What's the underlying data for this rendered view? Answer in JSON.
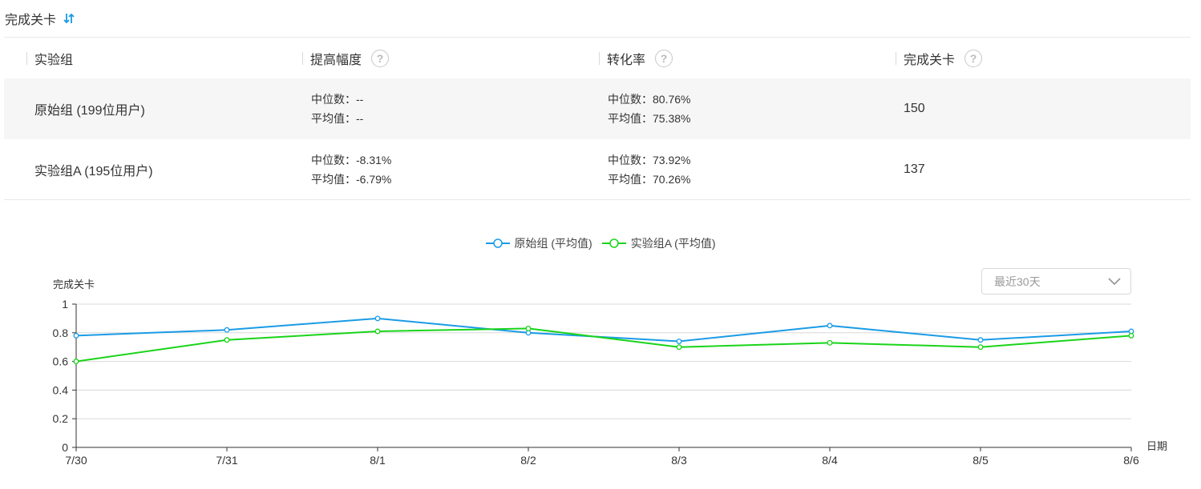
{
  "header": {
    "title": "完成关卡",
    "sort_icon": "sort-icon"
  },
  "table": {
    "columns": [
      {
        "label": "实验组",
        "help": false
      },
      {
        "label": "提高幅度",
        "help": true
      },
      {
        "label": "转化率",
        "help": true
      },
      {
        "label": "完成关卡",
        "help": true
      }
    ],
    "rows": [
      {
        "name": "原始组 (199位用户)",
        "lift_median": "中位数：--",
        "lift_mean": "平均值：--",
        "conv_median": "中位数：80.76%",
        "conv_mean": "平均值：75.38%",
        "value": "150"
      },
      {
        "name": "实验组A (195位用户)",
        "lift_median": "中位数：-8.31%",
        "lift_mean": "平均值：-6.79%",
        "conv_median": "中位数：73.92%",
        "conv_mean": "平均值：70.26%",
        "value": "137"
      }
    ]
  },
  "range_select": {
    "value": "最近30天"
  },
  "chart_data": {
    "type": "line",
    "title": "",
    "xlabel": "日期",
    "ylabel": "完成关卡",
    "x": [
      "7/30",
      "7/31",
      "8/1",
      "8/2",
      "8/3",
      "8/4",
      "8/5",
      "8/6"
    ],
    "ylim": [
      0,
      1
    ],
    "yticks": [
      "0",
      "0.2",
      "0.4",
      "0.6",
      "0.8",
      "1"
    ],
    "grid": true,
    "legend_position": "top",
    "series": [
      {
        "name": "原始组 (平均值)",
        "color": "#1a9be6",
        "values": [
          0.78,
          0.82,
          0.9,
          0.8,
          0.74,
          0.85,
          0.75,
          0.81
        ]
      },
      {
        "name": "实验组A (平均值)",
        "color": "#19d419",
        "values": [
          0.6,
          0.75,
          0.81,
          0.83,
          0.7,
          0.73,
          0.7,
          0.78
        ]
      }
    ]
  }
}
